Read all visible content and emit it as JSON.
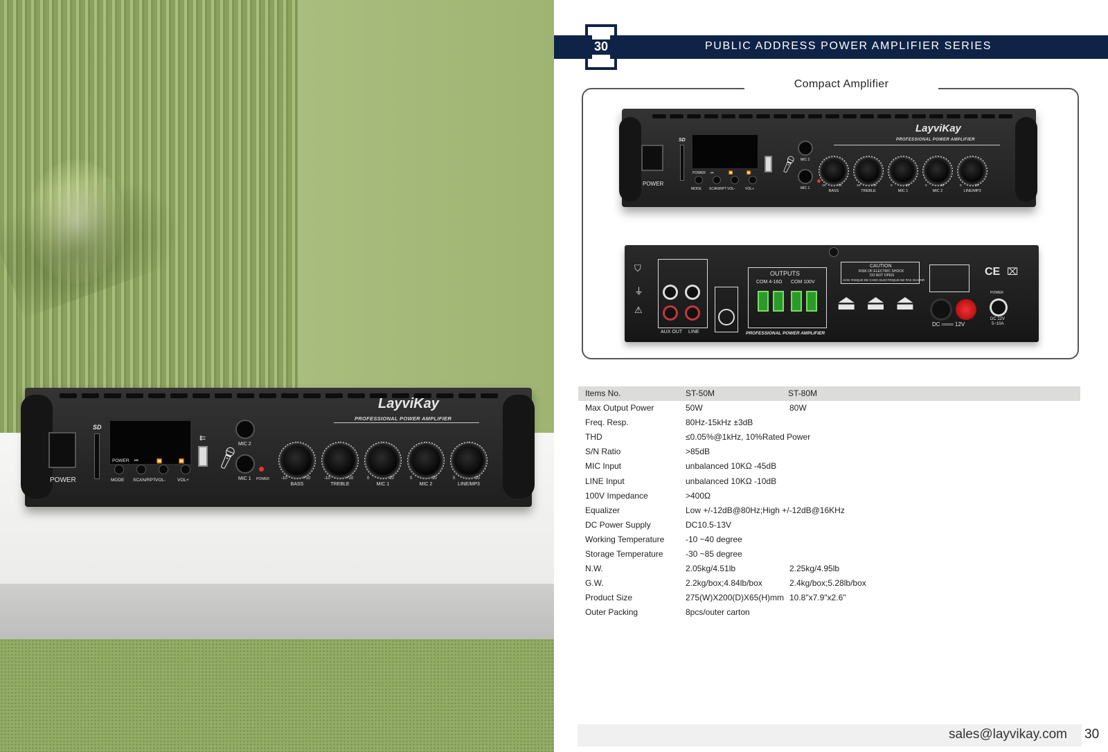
{
  "header": {
    "page_number": "30",
    "series_title": "PUBLIC  ADDRESS  POWER  AMPLIFIER  SERIES"
  },
  "section_title": "Compact  Amplifier",
  "amplifier_front": {
    "brand": "LayviKay",
    "tagline": "PROFESSIONAL POWER AMPLIFIER",
    "power_label": "POWER",
    "sd_label": "SD",
    "buttons_top": [
      "POWER",
      "⏮",
      "⏪",
      "⏩"
    ],
    "buttons_bottom": [
      "MODE",
      "SCAN/RPT",
      "VOL-",
      "VOL+"
    ],
    "mic2_label": "MIC 2",
    "mic1_label": "MIC 1",
    "power_led_label": "POWER",
    "knobs": [
      {
        "label": "BASS",
        "min": "-10",
        "max": "+10"
      },
      {
        "label": "TREBLE",
        "min": "-10",
        "max": "+10"
      },
      {
        "label": "MIC 1",
        "min": "0",
        "max": "10"
      },
      {
        "label": "MIC 2",
        "min": "0",
        "max": "10"
      },
      {
        "label": "LINE/MP3",
        "min": "0",
        "max": "10"
      }
    ]
  },
  "amplifier_rear": {
    "outputs_label": "OUTPUTS",
    "com_4_16": "COM  4-16Ω",
    "com_100v": "COM  100V",
    "caution": "CAUTION",
    "caution_sub1": "RISK OF ELECTRIC SHOCK",
    "caution_sub2": "DO NOT OPEN",
    "avis": "AVIS: RISQUE DE CHOC ELECTRIQUE-NE PAS OUVRIR",
    "aux_out": "AUX OUT",
    "line": "LINE",
    "tagline": "PROFESSIONAL POWER AMPLIFIER",
    "dc_label": "DC ═══ 12V",
    "power_label": "POWER",
    "dc_spec1": "DC 12V",
    "dc_spec2": "5~10A",
    "ce": "CE"
  },
  "spec_table": {
    "header": {
      "label": "Items No.",
      "a": "ST-50M",
      "b": "ST-80M"
    },
    "rows": [
      {
        "label": "Max Output Power",
        "a": "50W",
        "b": "80W"
      },
      {
        "label": "Freq. Resp.",
        "a": "80Hz-15kHz ±3dB",
        "b": ""
      },
      {
        "label": "THD",
        "a": "≤0.05%@1kHz, 10%Rated Power",
        "b": ""
      },
      {
        "label": "S/N Ratio",
        "a": ">85dB",
        "b": ""
      },
      {
        "label": "MIC Input",
        "a": "unbalanced 10KΩ -45dB",
        "b": ""
      },
      {
        "label": "LINE Input",
        "a": "unbalanced 10KΩ -10dB",
        "b": ""
      },
      {
        "label": "100V Impedance",
        "a": ">400Ω",
        "b": ""
      },
      {
        "label": "Equalizer",
        "a": "Low +/-12dB@80Hz;High +/-12dB@16KHz",
        "b": ""
      },
      {
        "label": "DC Power Supply",
        "a": "DC10.5-13V",
        "b": ""
      },
      {
        "label": "Working Temperature",
        "a": "-10 ~40 degree",
        "b": ""
      },
      {
        "label": "Storage Temperature",
        "a": "-30  ~85  degree",
        "b": ""
      },
      {
        "label": "N.W.",
        "a": "2.05kg/4.51lb",
        "b": "2.25kg/4.95lb"
      },
      {
        "label": "G.W.",
        "a": "2.2kg/box;4.84lb/box",
        "b": "2.4kg/box;5.28lb/box"
      },
      {
        "label": "Product Size",
        "a": "275(W)X200(D)X65(H)mm",
        "b": "10.8\"x7.9\"x2.6\""
      },
      {
        "label": "Outer Packing",
        "a": "8pcs/outer carton",
        "b": ""
      }
    ]
  },
  "footer": {
    "email": "sales@layvikay.com",
    "page_number": "30"
  },
  "colors": {
    "header_navy": "#0f2347",
    "background_green": "#a9bd7e",
    "table_header_gray": "#dcdcdb"
  }
}
